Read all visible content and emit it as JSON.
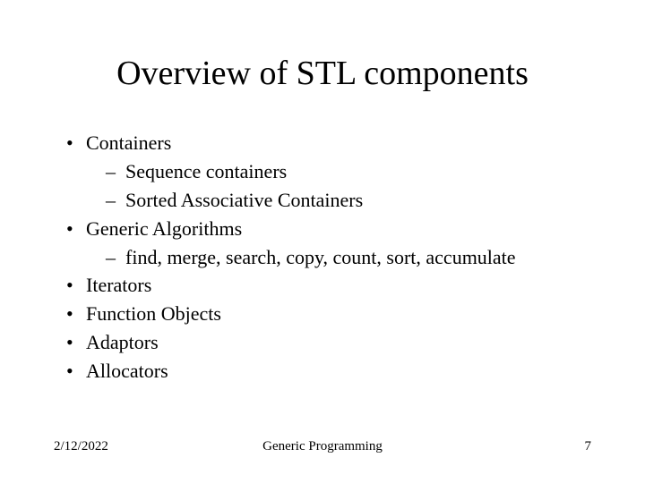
{
  "title": "Overview of STL components",
  "bullets": {
    "b0": "Containers",
    "b0_0": "Sequence containers",
    "b0_1": "Sorted Associative Containers",
    "b1": "Generic Algorithms",
    "b1_0": "find, merge, search, copy, count, sort, accumulate",
    "b2": "Iterators",
    "b3": "Function Objects",
    "b4": "Adaptors",
    "b5": "Allocators"
  },
  "footer": {
    "date": "2/12/2022",
    "center": "Generic Programming",
    "page": "7"
  }
}
